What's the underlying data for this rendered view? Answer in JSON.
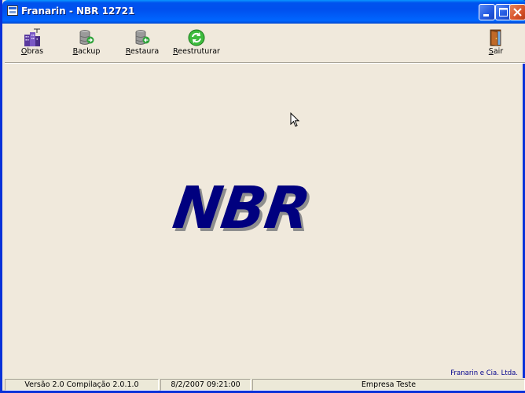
{
  "window": {
    "title": "Franarin - NBR 12721"
  },
  "toolbar": {
    "items": [
      {
        "label_u": "O",
        "label_rest": "bras",
        "icon": "building-icon"
      },
      {
        "label_u": "B",
        "label_rest": "ackup",
        "icon": "database-backup-icon"
      },
      {
        "label_u": "R",
        "label_rest": "estaura",
        "icon": "database-restore-icon"
      },
      {
        "label_u": "R",
        "label_rest": "eestruturar",
        "icon": "refresh-icon"
      }
    ],
    "exit": {
      "label_u": "S",
      "label_rest": "air",
      "icon": "exit-door-icon"
    }
  },
  "main": {
    "logo_text": "NBR",
    "company_note": "Franarin e Cia. Ltda."
  },
  "status": {
    "version": "Versão 2.0 Compilação 2.0.1.0",
    "datetime": "8/2/2007 09:21:00",
    "company": "Empresa Teste"
  },
  "colors": {
    "titlebar": "#0054E3",
    "logo": "#00007F",
    "background": "#F0E9DC"
  }
}
